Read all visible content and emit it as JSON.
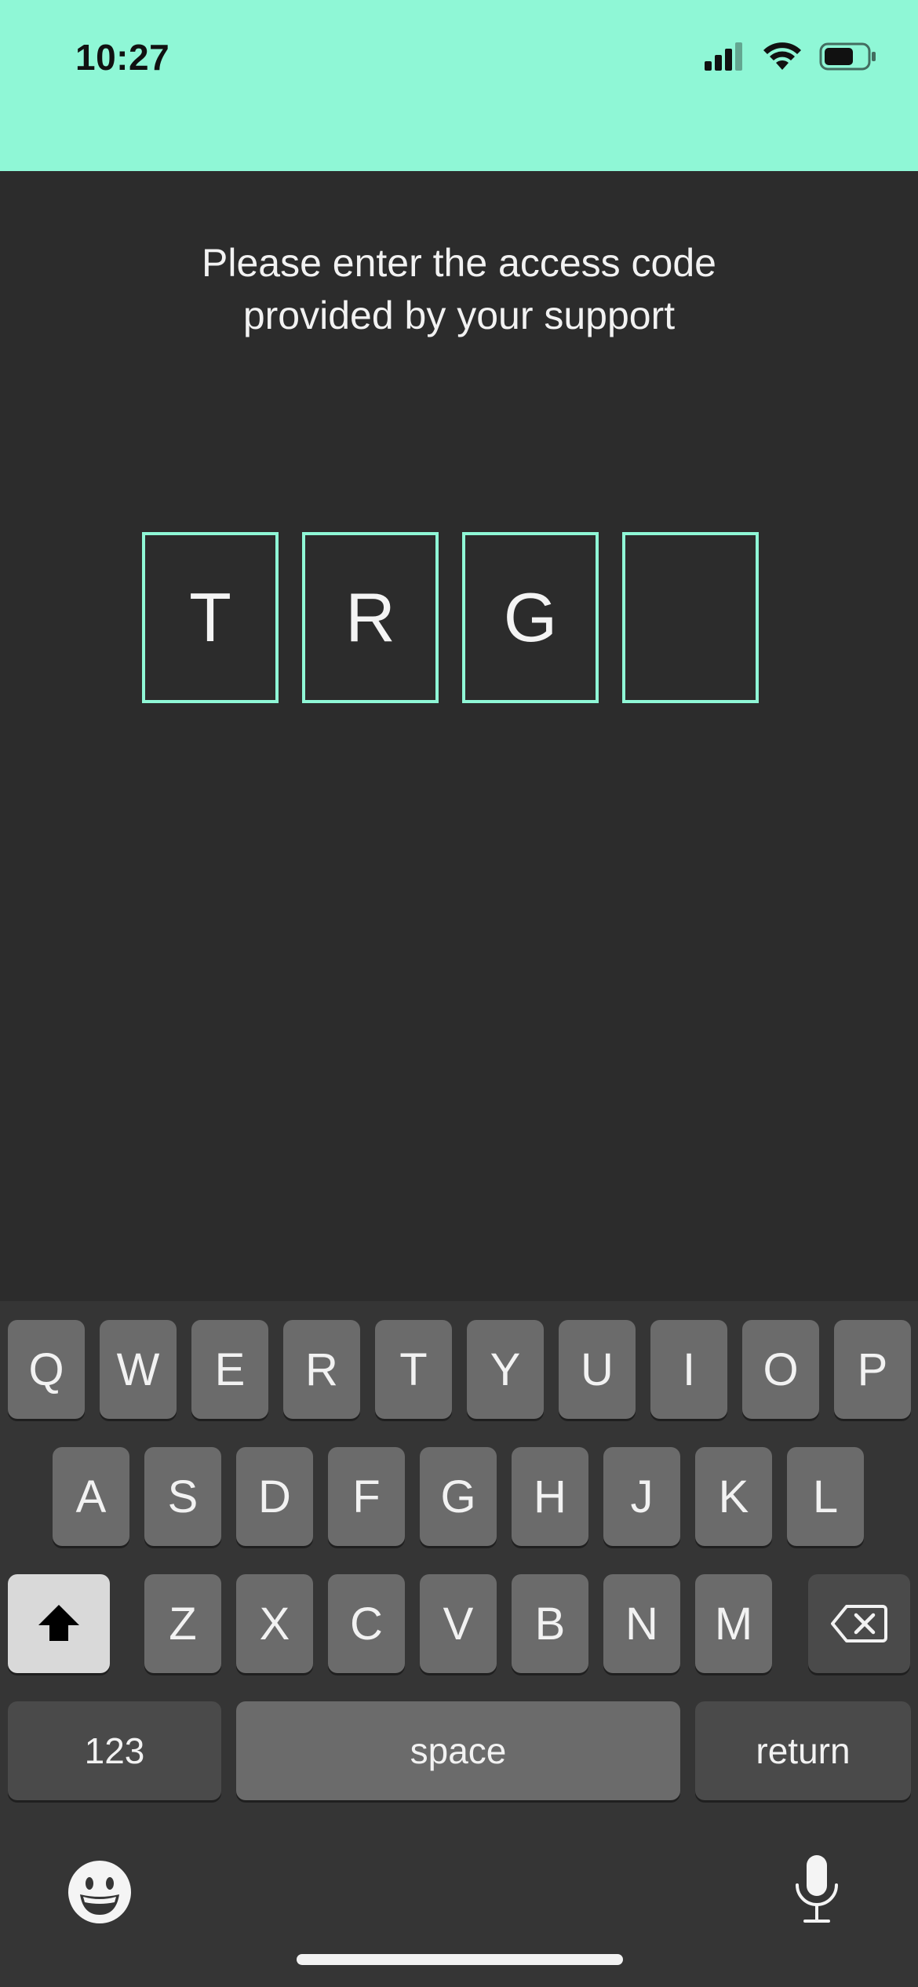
{
  "status_bar": {
    "time": "10:27"
  },
  "prompt": {
    "line1": "Please enter the access code",
    "line2": "provided by your support"
  },
  "code": {
    "chars": [
      "T",
      "R",
      "G",
      ""
    ]
  },
  "keyboard": {
    "row1": [
      "Q",
      "W",
      "E",
      "R",
      "T",
      "Y",
      "U",
      "I",
      "O",
      "P"
    ],
    "row2": [
      "A",
      "S",
      "D",
      "F",
      "G",
      "H",
      "J",
      "K",
      "L"
    ],
    "row3": [
      "Z",
      "X",
      "C",
      "V",
      "B",
      "N",
      "M"
    ],
    "numbers_label": "123",
    "space_label": "space",
    "return_label": "return"
  },
  "icons": {
    "signal": "cellular-signal-icon",
    "wifi": "wifi-icon",
    "battery": "battery-icon",
    "shift": "shift-icon",
    "delete": "backspace-icon",
    "emoji": "emoji-icon",
    "mic": "microphone-icon"
  },
  "colors": {
    "accent": "#8ff7d6",
    "background": "#2c2c2c",
    "key": "#6b6b6b"
  }
}
